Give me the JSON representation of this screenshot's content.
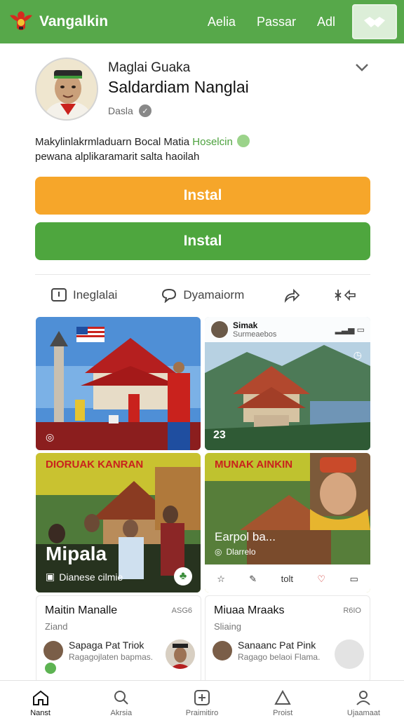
{
  "topbar": {
    "brand": "Vangalkin",
    "nav": [
      "Aelia",
      "Passar",
      "Adl"
    ],
    "colors": {
      "bar": "#57a84a",
      "action_bg": "#dceed8"
    }
  },
  "profile": {
    "name_small": "Maglai Guaka",
    "name_big": "Saldardiam Nanglai",
    "meta": "Dasla"
  },
  "description": {
    "line1_prefix": "Makylinlakrmladuarn Bocal Matia ",
    "line1_highlight": "Hoselcin",
    "line2": "pewana alplikaramarit salta haoilah"
  },
  "buttons": {
    "install_primary": "Instal",
    "install_secondary": "Instal",
    "colors": {
      "orange": "#f6a62a",
      "green": "#4ea63e"
    }
  },
  "actions": {
    "first": "Ineglalai",
    "second": "Dyamaiorm"
  },
  "cards": {
    "c2": {
      "title": "Simak",
      "subtitle": "Surmeaebos",
      "count": "23"
    },
    "c3": {
      "headline": "DIORUAK KANRAN",
      "big": "Mipala",
      "footer": "Dianese cilmie"
    },
    "c4": {
      "headline": "MUNAK AINKIN",
      "label": "Earpol ba...",
      "sub": "Dlarrelo",
      "toolbar_text": "tolt"
    }
  },
  "list": [
    {
      "title": "Maitin Manalle",
      "tag": "ASG6",
      "sub": "Ziand",
      "row_title": "Sapaga Pat Triok",
      "row_sub": "Ragagojlaten bapmas."
    },
    {
      "title": "Miuaa Mraaks",
      "tag": "R6IO",
      "sub": "Sliaing",
      "row_title": "Sanaanc Pat Pink",
      "row_sub": "Ragago belaoi Flama."
    }
  ],
  "bottom_nav": [
    "Nanst",
    "Akrsia",
    "Praimitiro",
    "Proist",
    "Ujaamaat"
  ]
}
